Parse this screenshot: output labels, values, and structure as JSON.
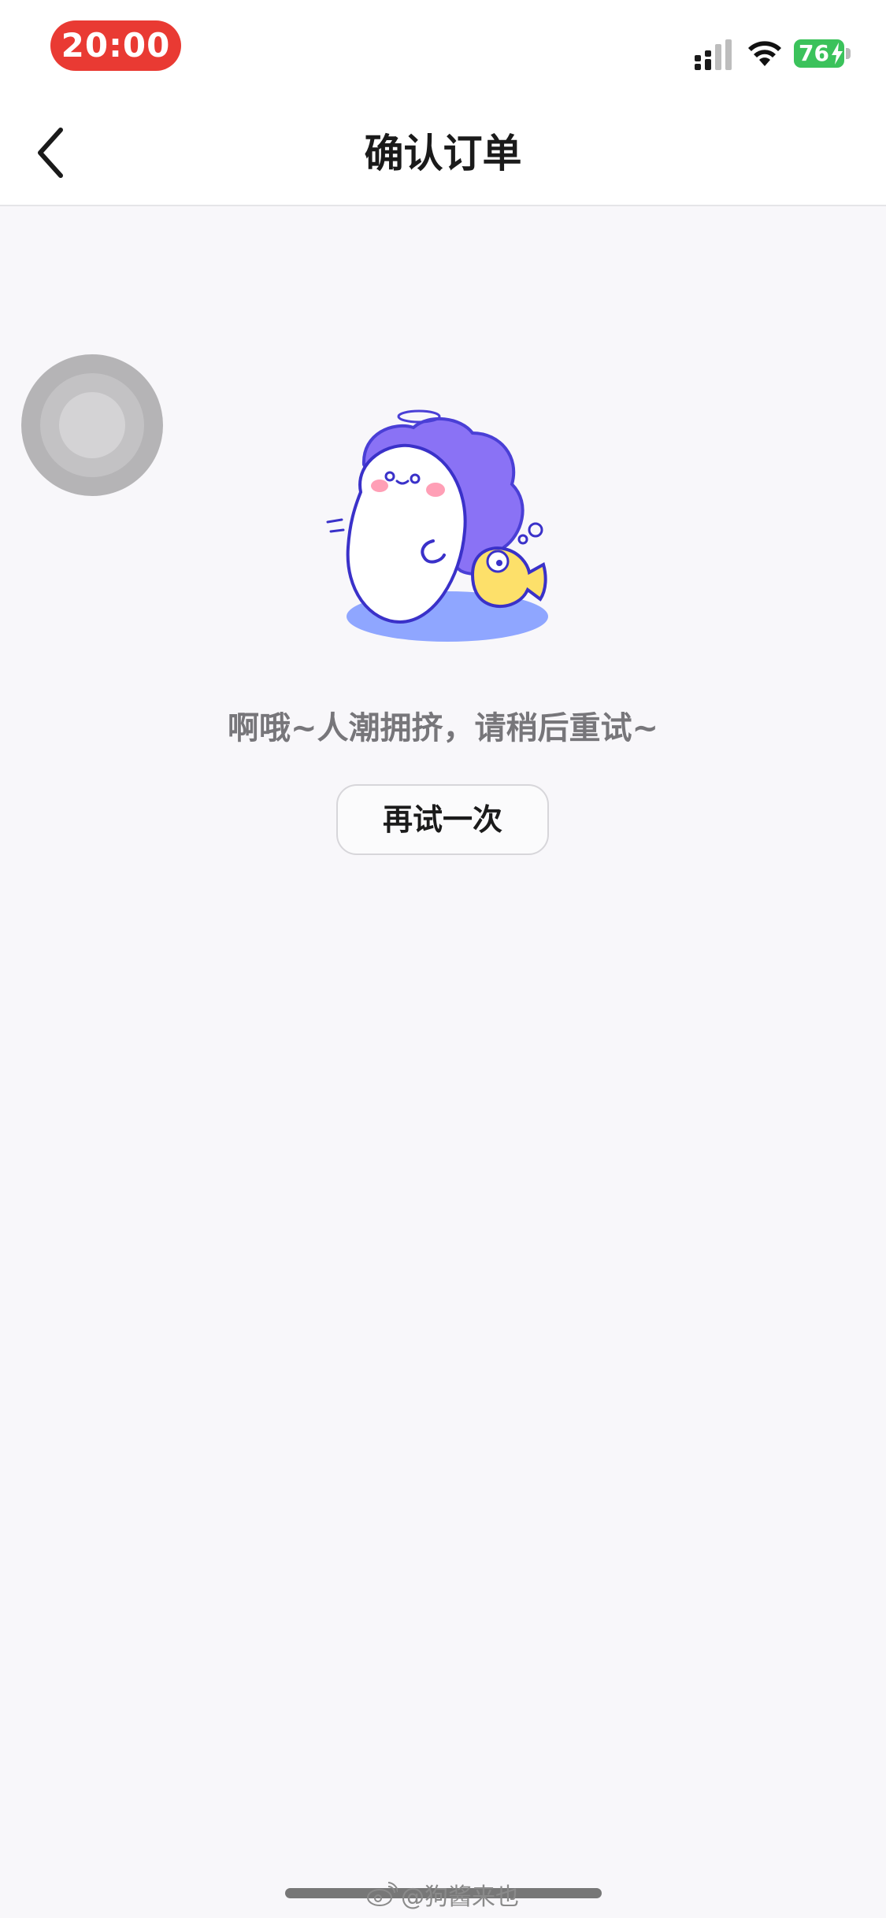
{
  "status_bar": {
    "time": "20:00",
    "battery_level": "76",
    "icons": [
      "signal-icon",
      "wifi-icon",
      "battery-icon",
      "charging-bolt-icon"
    ],
    "time_pill_color": "#e93a33",
    "battery_color": "#3bc25b"
  },
  "nav": {
    "back_icon": "chevron-left-icon",
    "title": "确认订单"
  },
  "main": {
    "illustration": "mascot-illustration",
    "message": "啊哦~人潮拥挤，请稍后重试~",
    "retry_label": "再试一次"
  },
  "overlay": {
    "assistive_touch": "assistive-touch-button"
  },
  "watermark": {
    "text": "@狗酱来也",
    "icon": "weibo-icon"
  }
}
